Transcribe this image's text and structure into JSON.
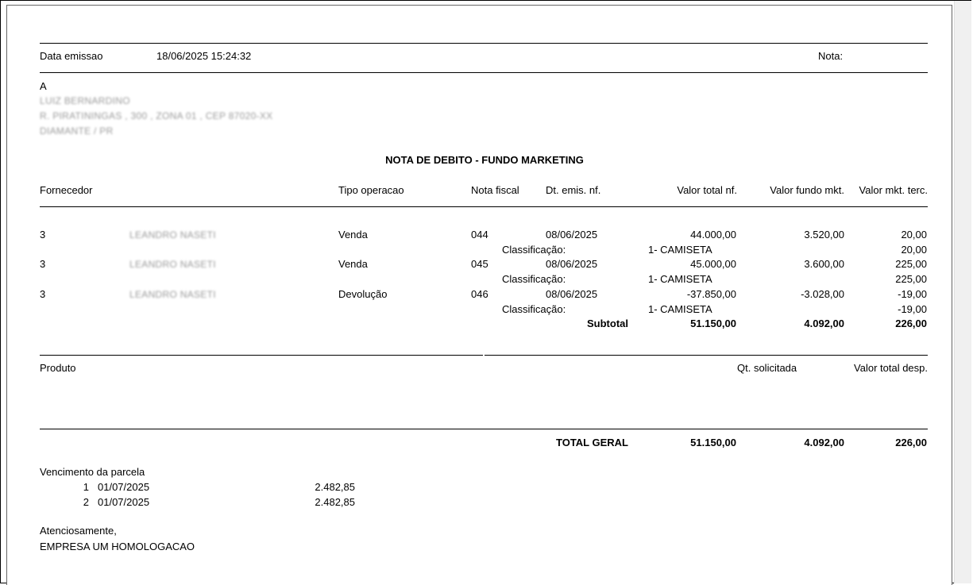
{
  "header": {
    "data_emissao_label": "Data emissao",
    "data_emissao_value": "18/06/2025 15:24:32",
    "nota_label": "Nota:"
  },
  "recipient": {
    "to_label": "A",
    "name": "LUIZ BERNARDINO",
    "address": "R. PIRATININGAS , 300 , ZONA 01 , CEP 87020-XX",
    "city": "DIAMANTE / PR"
  },
  "title": "NOTA DE DEBITO - FUNDO MARKETING",
  "table": {
    "headers": {
      "fornecedor": "Fornecedor",
      "tipo": "Tipo operacao",
      "nota": "Nota fiscal",
      "dt": "Dt. emis. nf.",
      "valor_total": "Valor total nf.",
      "valor_fundo": "Valor fundo mkt.",
      "valor_terc": "Valor mkt. terc."
    },
    "rows": [
      {
        "code": "3",
        "name": "LEANDRO NASETI",
        "tipo": "Venda",
        "nota": "044",
        "dt": "08/06/2025",
        "valor_total": "44.000,00",
        "valor_fundo": "3.520,00",
        "valor_terc": "20,00",
        "class_label": "Classificação:",
        "class_value": "1- CAMISETA",
        "class_terc": "20,00"
      },
      {
        "code": "3",
        "name": "LEANDRO NASETI",
        "tipo": "Venda",
        "nota": "045",
        "dt": "08/06/2025",
        "valor_total": "45.000,00",
        "valor_fundo": "3.600,00",
        "valor_terc": "225,00",
        "class_label": "Classificação:",
        "class_value": "1- CAMISETA",
        "class_terc": "225,00"
      },
      {
        "code": "3",
        "name": "LEANDRO NASETI",
        "tipo": "Devolução",
        "nota": "046",
        "dt": "08/06/2025",
        "valor_total": "-37.850,00",
        "valor_fundo": "-3.028,00",
        "valor_terc": "-19,00",
        "class_label": "Classificação:",
        "class_value": "1- CAMISETA",
        "class_terc": "-19,00"
      }
    ],
    "subtotal": {
      "label": "Subtotal",
      "valor_total": "51.150,00",
      "valor_fundo": "4.092,00",
      "valor_terc": "226,00"
    }
  },
  "produto": {
    "produto_label": "Produto",
    "qt_label": "Qt. solicitada",
    "valor_label": "Valor total desp."
  },
  "total_geral": {
    "label": "TOTAL GERAL",
    "valor_total": "51.150,00",
    "valor_fundo": "4.092,00",
    "valor_terc": "226,00"
  },
  "vencimento": {
    "label": "Vencimento da parcela",
    "parcelas": [
      {
        "num": "1",
        "date": "01/07/2025",
        "value": "2.482,85"
      },
      {
        "num": "2",
        "date": "01/07/2025",
        "value": "2.482,85"
      }
    ]
  },
  "footer": {
    "greeting": "Atenciosamente,",
    "company": "EMPRESA UM HOMOLOGACAO"
  }
}
